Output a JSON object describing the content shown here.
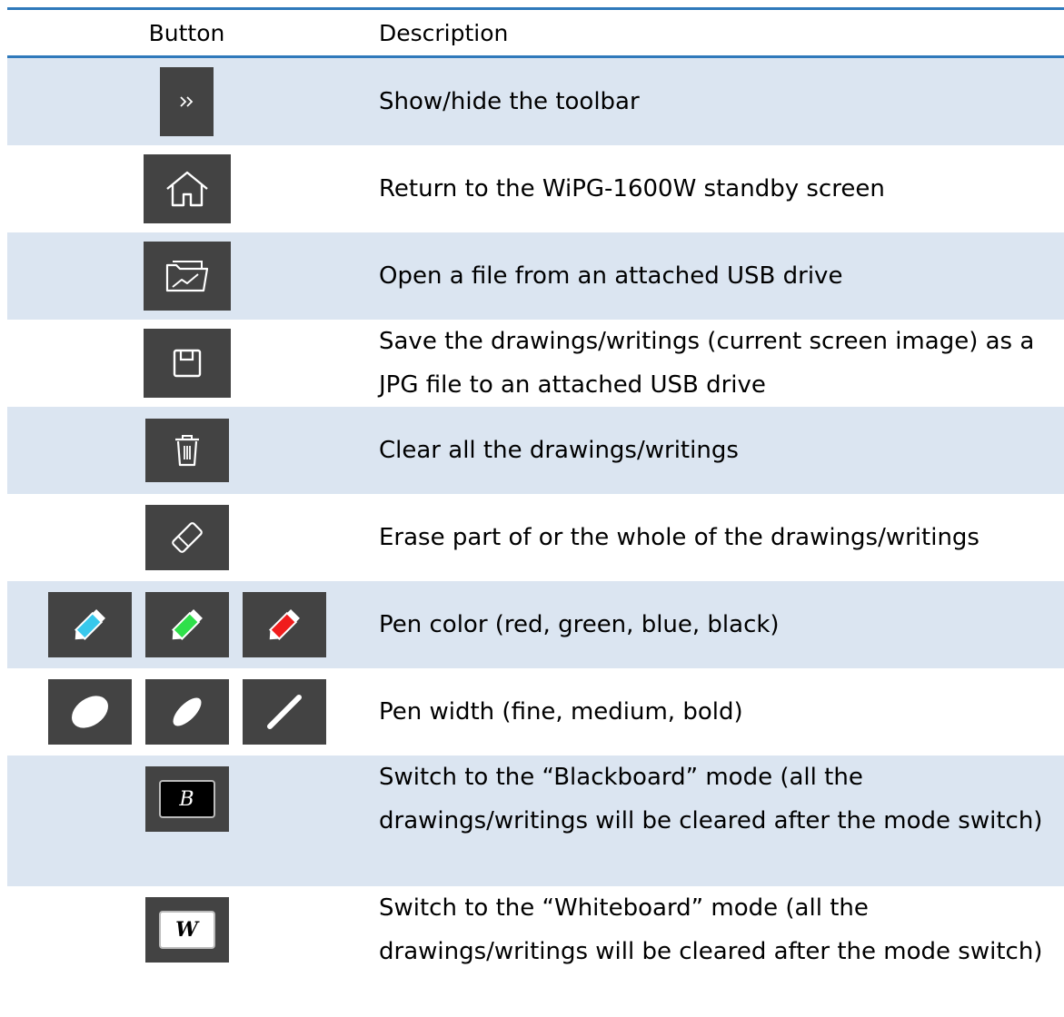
{
  "header": {
    "button": "Button",
    "description": "Description"
  },
  "colors": {
    "header_rule": "#2f79bb",
    "row_shade": "#dbe5f1",
    "icon_bg": "#434343"
  },
  "rows": [
    {
      "icons": [
        "chevron-double-right-icon"
      ],
      "description": "Show/hide the toolbar"
    },
    {
      "icons": [
        "home-icon"
      ],
      "description": "Return to the WiPG-1600W standby screen"
    },
    {
      "icons": [
        "open-folder-icon"
      ],
      "description": "Open a file from an attached USB drive"
    },
    {
      "icons": [
        "floppy-disk-icon"
      ],
      "description": "Save the drawings/writings (current screen image) as a JPG file to an attached USB drive"
    },
    {
      "icons": [
        "trash-icon"
      ],
      "description": "Clear all the drawings/writings"
    },
    {
      "icons": [
        "eraser-icon"
      ],
      "description": "Erase part of or the whole of the drawings/writings"
    },
    {
      "icons": [
        "pen-blue-icon",
        "pen-green-icon",
        "pen-red-icon"
      ],
      "description": "Pen color (red, green, blue, black)"
    },
    {
      "icons": [
        "pen-width-bold-icon",
        "pen-width-medium-icon",
        "pen-width-fine-icon"
      ],
      "description": "Pen width (fine, medium, bold)"
    },
    {
      "icons": [
        "blackboard-icon"
      ],
      "icon_text": "B",
      "description": "Switch to the “Blackboard” mode (all the drawings/writings will be cleared after the mode switch)"
    },
    {
      "icons": [
        "whiteboard-icon"
      ],
      "icon_text": "W",
      "description": "Switch to the “Whiteboard” mode (all the drawings/writings will be cleared after the mode switch)"
    }
  ]
}
